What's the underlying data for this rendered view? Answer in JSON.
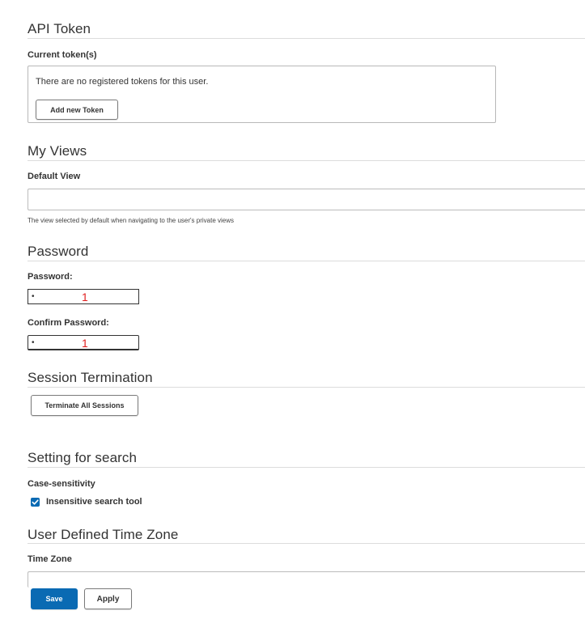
{
  "api_token": {
    "title": "API Token",
    "current_label": "Current token(s)",
    "empty_text": "There are no registered tokens for this user.",
    "add_button": "Add new Token"
  },
  "my_views": {
    "title": "My Views",
    "default_view_label": "Default View",
    "default_view_value": "",
    "help_text": "The view selected by default when navigating to the user's private views"
  },
  "password": {
    "title": "Password",
    "password_label": "Password:",
    "password_mask": "•",
    "password_annotation": "1",
    "confirm_label": "Confirm Password:",
    "confirm_mask": "•",
    "confirm_annotation": "1"
  },
  "session": {
    "title": "Session Termination",
    "terminate_button": "Terminate All Sessions"
  },
  "search": {
    "title": "Setting for search",
    "case_label": "Case-sensitivity",
    "checkbox_label": "Insensitive search tool",
    "checkbox_checked": true
  },
  "timezone": {
    "title": "User Defined Time Zone",
    "label": "Time Zone"
  },
  "actions": {
    "save": "Save",
    "apply": "Apply"
  },
  "colors": {
    "primary": "#0a6ab3",
    "annotation": "#e02020"
  }
}
